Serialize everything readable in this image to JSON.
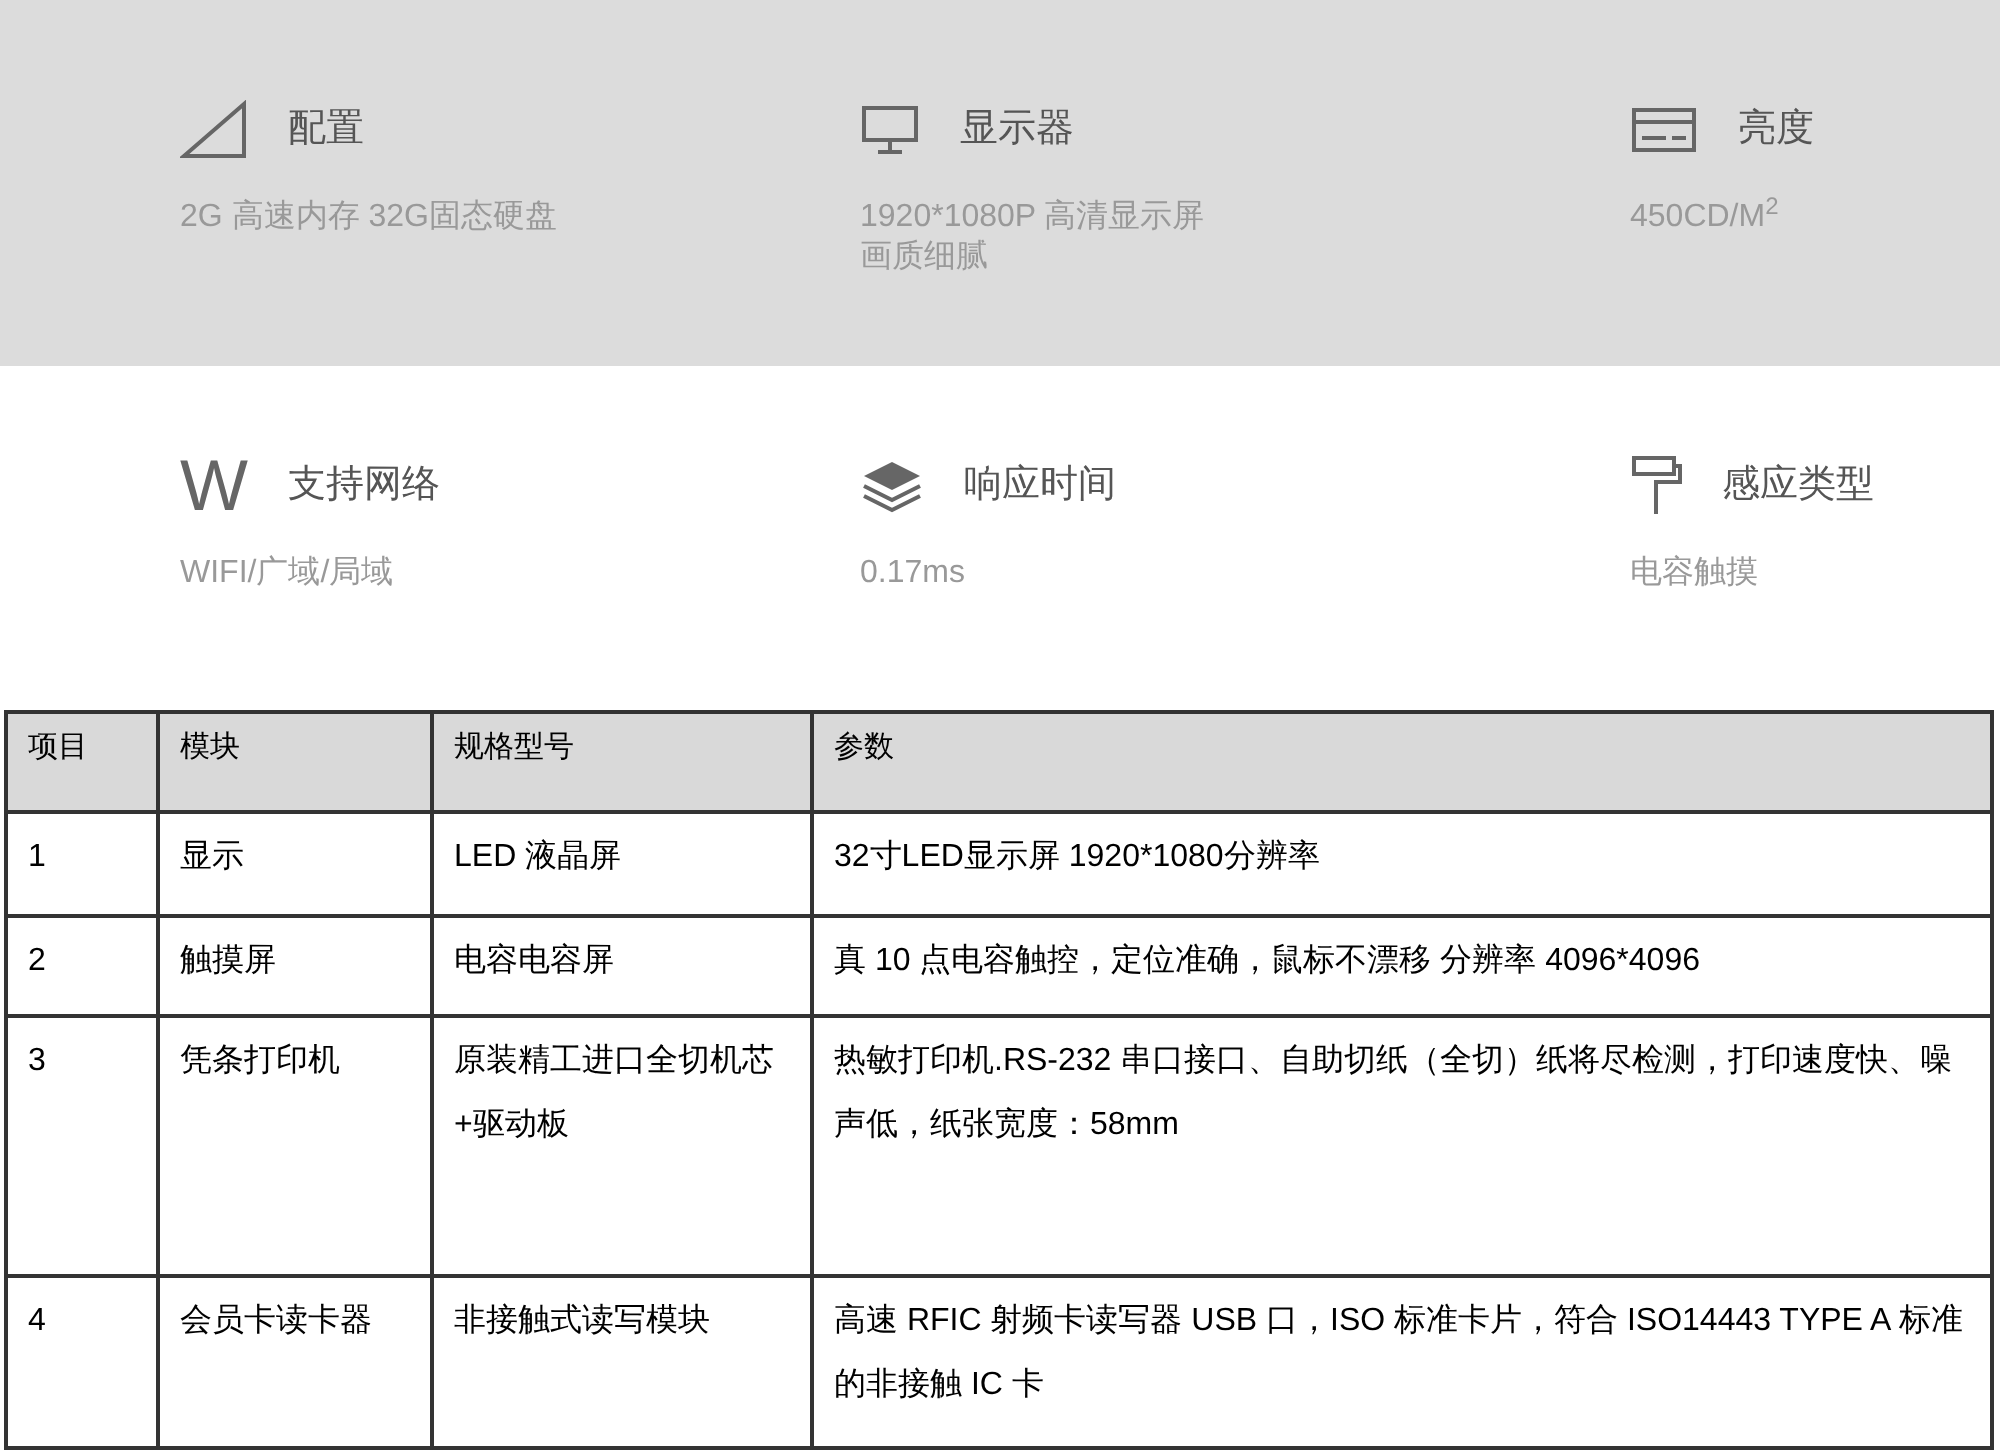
{
  "features_top": [
    {
      "title": "配置",
      "desc": [
        "2G 高速内存 32G固态硬盘"
      ]
    },
    {
      "title": "显示器",
      "desc": [
        "1920*1080P 高清显示屏",
        "画质细腻"
      ]
    },
    {
      "title": "亮度",
      "desc": [
        "450CD/M$^{2}$"
      ]
    }
  ],
  "features_bottom": [
    {
      "glyph": "W",
      "title": "支持网络",
      "desc": [
        "WIFI/广域/局域"
      ]
    },
    {
      "title": "响应时间",
      "desc": [
        "0.17ms"
      ]
    },
    {
      "title": "感应类型",
      "desc": [
        "电容触摸"
      ]
    }
  ],
  "table": {
    "columns": [
      "项目",
      "模块",
      "规格型号",
      "参数"
    ],
    "rows": [
      [
        "1",
        "显示",
        "LED 液晶屏",
        "32寸LED显示屏  1920*1080分辨率"
      ],
      [
        "2",
        "触摸屏",
        "电容电容屏",
        "真 10 点电容触控，定位准确，鼠标不漂移  分辨率 4096*4096"
      ],
      [
        "3",
        "凭条打印机",
        "原装精工进口全切机芯+驱动板",
        "热敏打印机.RS-232 串口接口、自助切纸（全切）纸将尽检测，打印速度快、噪声低，纸张宽度：58mm"
      ],
      [
        "4",
        "会员卡读卡器",
        "非接触式读写模块",
        "高速 RFIC 射频卡读写器   USB 口，ISO 标准卡片，符合 ISO14443  TYPE A 标准的非接触 IC 卡"
      ]
    ]
  }
}
